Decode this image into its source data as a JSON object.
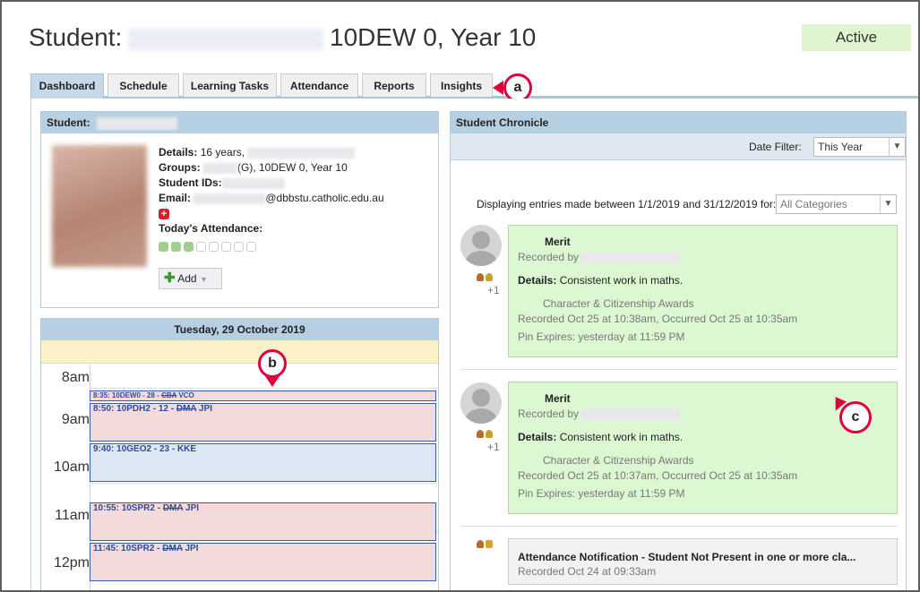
{
  "page": {
    "title_prefix": "Student:",
    "title_group": "10DEW 0, Year 10",
    "status": "Active"
  },
  "tabs": [
    "Dashboard",
    "Schedule",
    "Learning Tasks",
    "Attendance",
    "Reports",
    "Insights"
  ],
  "callouts": {
    "a": "a",
    "b": "b",
    "c": "c"
  },
  "student_panel": {
    "header": "Student:",
    "details_label": "Details:",
    "details_value": "16 years,",
    "groups_label": "Groups:",
    "groups_value": "(G), 10DEW 0, Year 10",
    "ids_label": "Student IDs:",
    "email_label": "Email:",
    "email_value": "@dbbstu.catholic.edu.au",
    "attendance_label": "Today's Attendance:",
    "attendance": {
      "present": 3,
      "total": 8
    },
    "add_label": "Add"
  },
  "schedule": {
    "date": "Tuesday, 29 October 2019",
    "hours": [
      "8am",
      "9am",
      "10am",
      "11am",
      "12pm"
    ],
    "events": [
      {
        "time": "8:35:",
        "code": "10DEW0 - 28 -",
        "struck": "CBA",
        "teacher": "VCO",
        "color": "pink"
      },
      {
        "time": "8:50:",
        "code": "10PDH2 - 12 -",
        "struck": "DMA",
        "teacher": "JPI",
        "color": "pink"
      },
      {
        "time": "9:40:",
        "code": "10GEO2 - 23 - KKE",
        "struck": "",
        "teacher": "",
        "color": "blue"
      },
      {
        "time": "10:55:",
        "code": "10SPR2 -",
        "struck": "DMA",
        "teacher": "JPI",
        "color": "pink"
      },
      {
        "time": "11:45:",
        "code": "10SPR2 -",
        "struck": "DMA",
        "teacher": "JPI",
        "color": "pink"
      }
    ]
  },
  "chronicle": {
    "header": "Student Chronicle",
    "date_filter_label": "Date Filter:",
    "date_filter_value": "This Year",
    "displaying_text": "Displaying entries made between 1/1/2019 and 31/12/2019 for:",
    "category_value": "All Categories",
    "entries": [
      {
        "title": "Merit",
        "recorded_by": "Recorded by",
        "extra": "+1",
        "details_label": "Details:",
        "details": "Consistent work in maths.",
        "category": "Character & Citizenship Awards",
        "recorded": "Recorded Oct 25 at 10:38am, Occurred Oct 25 at 10:35am",
        "pin": "Pin Expires: yesterday at 11:59 PM"
      },
      {
        "title": "Merit",
        "recorded_by": "Recorded by",
        "extra": "+1",
        "details_label": "Details:",
        "details": "Consistent work in maths.",
        "category": "Character & Citizenship Awards",
        "recorded": "Recorded Oct 25 at 10:37am, Occurred Oct 25 at 10:35am",
        "pin": "Pin Expires: yesterday at 11:59 PM"
      }
    ],
    "notification": {
      "title": "Attendance Notification - Student Not Present in one or more cla...",
      "recorded": "Recorded Oct 24 at 09:33am"
    }
  },
  "colors": {
    "accent": "#b7cfe2",
    "card_green": "#dcf8d3",
    "callout": "#e0003c",
    "status_bg": "#dff5d0"
  }
}
